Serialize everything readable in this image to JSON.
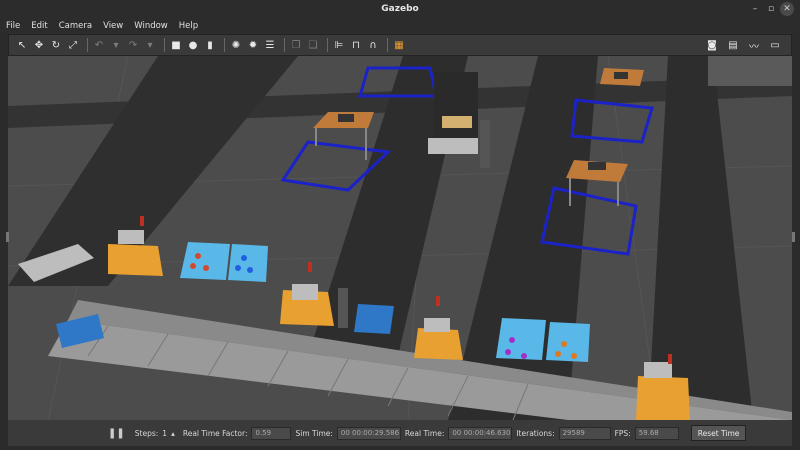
{
  "window": {
    "title": "Gazebo"
  },
  "menu": [
    "File",
    "Edit",
    "Camera",
    "View",
    "Window",
    "Help"
  ],
  "status": {
    "steps_label": "Steps:",
    "steps_value": "1",
    "rtf_label": "Real Time Factor:",
    "rtf_value": "0.59",
    "sim_time_label": "Sim Time:",
    "sim_time_value": "00 00:00:29.586",
    "real_time_label": "Real Time:",
    "real_time_value": "00 00:00:46.630",
    "iterations_label": "Iterations:",
    "iterations_value": "29589",
    "fps_label": "FPS:",
    "fps_value": "59.68",
    "reset_label": "Reset Time"
  },
  "colors": {
    "floor": "#4c4c4c",
    "lane": "#2d2d2d",
    "table_top": "#c07a3a",
    "target_outline": "#1a22c8",
    "conveyor": "#9a9a9a",
    "bin": "#3aa0e0",
    "agv": "#e8a030"
  }
}
